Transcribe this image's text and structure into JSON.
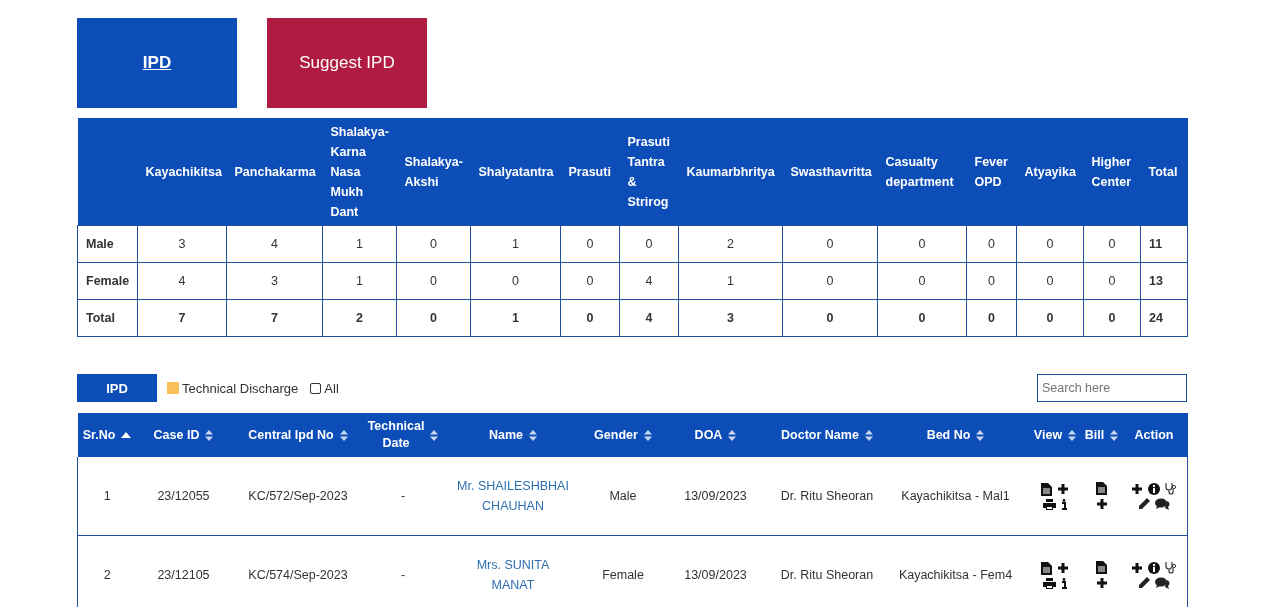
{
  "tabs": [
    {
      "label": "IPD",
      "selected": true
    },
    {
      "label": "Suggest IPD",
      "selected": false
    }
  ],
  "summary": {
    "columns": [
      "Kayachikitsa",
      "Panchakarma",
      "Shalakya-Karna Nasa Mukh Dant",
      "Shalakya-Akshi",
      "Shalyatantra",
      "Prasuti",
      "Prasuti Tantra & Strirog",
      "Kaumarbhritya",
      "Swasthavritta",
      "Casualty department",
      "Fever OPD",
      "Atyayika",
      "Higher Center",
      "Total"
    ],
    "rows": [
      {
        "kind": "count",
        "label": "Male",
        "values": [
          "3",
          "4",
          "1",
          "0",
          "1",
          "0",
          "0",
          "2",
          "0",
          "0",
          "0",
          "0",
          "0",
          "11"
        ]
      },
      {
        "kind": "count",
        "label": "Female",
        "values": [
          "4",
          "3",
          "1",
          "0",
          "0",
          "0",
          "4",
          "1",
          "0",
          "0",
          "0",
          "0",
          "0",
          "13"
        ]
      },
      {
        "kind": "total",
        "label": "Total",
        "values": [
          "7",
          "7",
          "2",
          "0",
          "1",
          "0",
          "4",
          "3",
          "0",
          "0",
          "0",
          "0",
          "0",
          "24"
        ]
      }
    ]
  },
  "toolbar": {
    "button": "IPD",
    "legend": {
      "label": "Technical Discharge",
      "color": "#f9c05c"
    },
    "all_checkbox": {
      "label": "All",
      "checked": false
    },
    "search": {
      "placeholder": "Search here"
    }
  },
  "table": {
    "columns": [
      {
        "label": "Sr.No",
        "sortable": true,
        "sorted_ascending": true
      },
      {
        "label": "Case ID",
        "sortable": true,
        "sorted_ascending": false
      },
      {
        "label": "Central Ipd No",
        "sortable": true,
        "sorted_ascending": false
      },
      {
        "label": "Technical Date",
        "sortable": true,
        "sorted_ascending": false
      },
      {
        "label": "Name",
        "sortable": true,
        "sorted_ascending": false
      },
      {
        "label": "Gender",
        "sortable": true,
        "sorted_ascending": false
      },
      {
        "label": "DOA",
        "sortable": true,
        "sorted_ascending": false
      },
      {
        "label": "Doctor Name",
        "sortable": true,
        "sorted_ascending": false
      },
      {
        "label": "Bed No",
        "sortable": true,
        "sorted_ascending": false
      },
      {
        "label": "View",
        "sortable": true,
        "sorted_ascending": false
      },
      {
        "label": "Bill",
        "sortable": true,
        "sorted_ascending": false
      },
      {
        "label": "Action",
        "sortable": false
      }
    ],
    "rows": [
      {
        "sr": "1",
        "case_id": "23/12055",
        "central_ipd_no": "KC/572/Sep-2023",
        "technical_date": "-",
        "name": "Mr. SHAILESHBHAI CHAUHAN",
        "gender": "Male",
        "doa": "13/09/2023",
        "doctor": "Dr. Ritu Sheoran",
        "bed": "Kayachikitsa - Mal1"
      },
      {
        "sr": "2",
        "case_id": "23/12105",
        "central_ipd_no": "KC/574/Sep-2023",
        "technical_date": "-",
        "name": "Mrs. SUNITA MANAT",
        "gender": "Female",
        "doa": "13/09/2023",
        "doctor": "Dr. Ritu Sheoran",
        "bed": "Kayachikitsa - Fem4"
      }
    ]
  }
}
